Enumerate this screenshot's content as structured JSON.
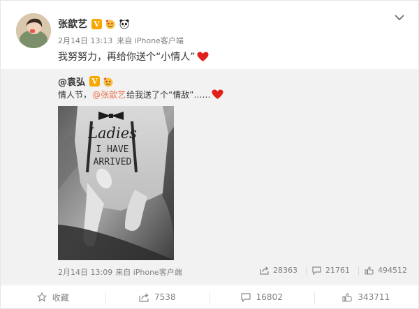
{
  "post": {
    "author": "张歆艺",
    "time": "2月14日 13:13",
    "source": "来自 iPhone客户端",
    "text": "我努努力，再给你送个“小情人”"
  },
  "repost": {
    "author": "@袁弘",
    "text_before": "情人节，",
    "mention": "@张歆艺",
    "text_after": " 给我送了个“情敌”……",
    "photo_text": [
      "Ladies",
      "I HAVE",
      "ARRIVED"
    ],
    "time": "2月14日 13:09",
    "source": "来自 iPhone客户端",
    "shares": "28363",
    "comments": "21761",
    "likes": "494512"
  },
  "bottom_bar": {
    "favorite_label": "收藏",
    "shares": "7538",
    "comments": "16802",
    "likes": "343711"
  },
  "colors": {
    "mention": "#eb7350",
    "badge": "#f7a700",
    "heart": "#e0201a"
  },
  "icons": [
    "chevron-down-icon",
    "verified-v-icon",
    "emoji-badge-icon",
    "panda-icon",
    "heart-icon",
    "star-icon",
    "share-icon",
    "comment-icon",
    "like-icon"
  ]
}
